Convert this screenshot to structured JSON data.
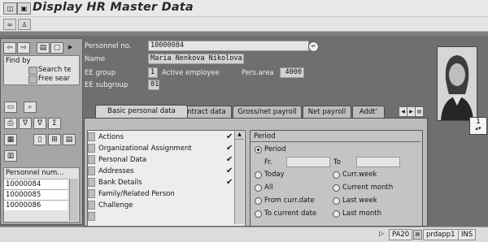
{
  "title": "Display HR Master Data",
  "left_panel": {
    "find_by_label": "Find by",
    "find_items": [
      "Search te",
      "Free sear"
    ],
    "table_header": "Personnel num...",
    "personnel_numbers": [
      "10000084",
      "10000085",
      "10000086"
    ]
  },
  "header": {
    "personnel_no_label": "Personnel no.",
    "personnel_no_value": "10000084",
    "name_label": "Name",
    "name_value": "Maria Nenkova Nikolova",
    "ee_group_label": "EE group",
    "ee_group_value": "1",
    "ee_group_text": "Active employee",
    "pers_area_label": "Pers.area",
    "pers_area_value": "4000",
    "ee_subgroup_label": "EE subgroup",
    "ee_subgroup_value": "01",
    "photo_counter": "1"
  },
  "tabs": [
    "Basic personal data",
    "Contract data",
    "Gross/net payroll",
    "Net payroll",
    "Addt'"
  ],
  "infotypes": [
    {
      "label": "Actions",
      "checked": true
    },
    {
      "label": "Organizational Assignment",
      "checked": true
    },
    {
      "label": "Personal Data",
      "checked": true
    },
    {
      "label": "Addresses",
      "checked": true
    },
    {
      "label": "Bank Details",
      "checked": true
    },
    {
      "label": "Family/Related Person",
      "checked": false
    },
    {
      "label": "Challenge",
      "checked": false
    }
  ],
  "period": {
    "group_label": "Period",
    "period_option": "Period",
    "from_label": "Fr.",
    "to_label": "To",
    "options_left": [
      "Today",
      "All",
      "From curr.date",
      "To current date"
    ],
    "options_right": [
      "Curr.week",
      "Current month",
      "Last week",
      "Last month"
    ]
  },
  "status": {
    "transaction": "PA20",
    "server": "prdapp1",
    "mode": "INS"
  },
  "icons": {
    "check": "✔"
  }
}
